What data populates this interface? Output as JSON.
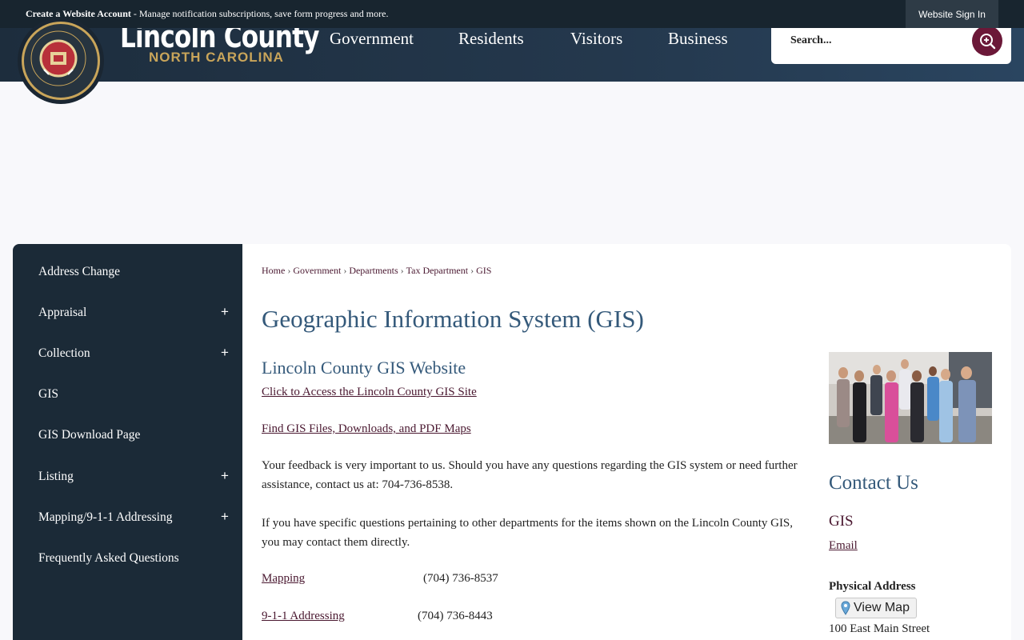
{
  "topbar": {
    "create_account": "Create a Website Account",
    "message": " - Manage notification subscriptions, save form progress and more.",
    "sign_in": "Website Sign In"
  },
  "brand": {
    "name": "Lincoln County",
    "sub": "NORTH CAROLINA",
    "seal_text": "LINCOLN COUNTY NORTH CAROLINA EST 1779"
  },
  "nav": [
    "Government",
    "Residents",
    "Visitors",
    "Business"
  ],
  "search": {
    "placeholder": "Search..."
  },
  "sidebar": {
    "items": [
      {
        "label": "Address Change",
        "expandable": false
      },
      {
        "label": "Appraisal",
        "expandable": true
      },
      {
        "label": "Collection",
        "expandable": true
      },
      {
        "label": "GIS",
        "expandable": false
      },
      {
        "label": "GIS Download Page",
        "expandable": false
      },
      {
        "label": "Listing",
        "expandable": true
      },
      {
        "label": "Mapping/9-1-1 Addressing",
        "expandable": true
      },
      {
        "label": "Frequently Asked Questions",
        "expandable": false
      }
    ],
    "plus": "+"
  },
  "breadcrumb": [
    "Home",
    "Government",
    "Departments",
    "Tax Department",
    "GIS"
  ],
  "breadcrumb_sep": "›",
  "page": {
    "title": "Geographic Information System (GIS)",
    "subtitle": "Lincoln County GIS Website",
    "link_gis_site": "Click to Access the Lincoln County GIS Site",
    "link_downloads": "Find GIS Files, Downloads, and PDF Maps",
    "para_feedback": "Your feedback is very important to us. Should you have any questions regarding the GIS system or need further assistance, contact us at: 704-736-8538.",
    "para_departments": "If you have specific questions pertaining to other departments for the items shown on the Lincoln County GIS, you may contact them directly.",
    "contacts": [
      {
        "name": "Mapping",
        "phone": "(704) 736-8537"
      },
      {
        "name": "9-1-1 Addressing",
        "phone": "(704) 736-8443"
      }
    ]
  },
  "contact": {
    "title": "Contact Us",
    "dept": "GIS",
    "email": "Email",
    "address_label": "Physical Address",
    "view_map": "View Map",
    "street": "100 East Main Street"
  },
  "colors": {
    "header_bg": "#1d2d3d",
    "sidebar_bg": "#1b2a37",
    "accent_gold": "#c9a55a",
    "heading_blue": "#34597a",
    "link_maroon": "#4a1830",
    "search_button": "#6b1838"
  }
}
